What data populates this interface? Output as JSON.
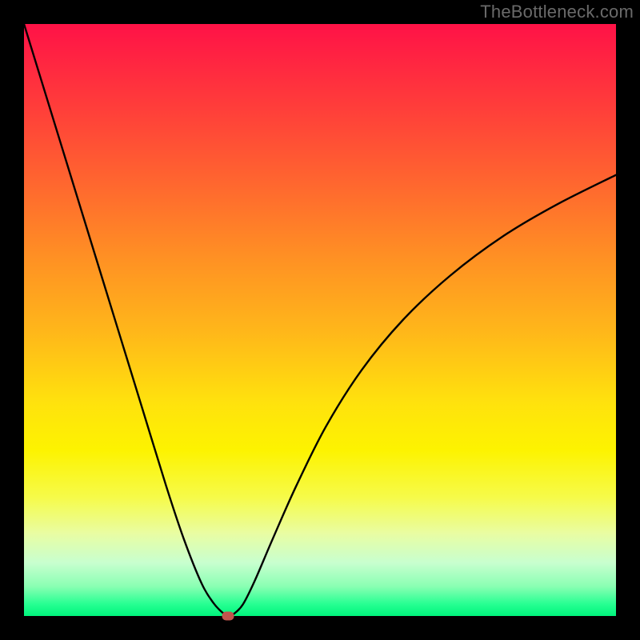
{
  "watermark": "TheBottleneck.com",
  "chart_data": {
    "type": "line",
    "title": "",
    "xlabel": "",
    "ylabel": "",
    "xlim": [
      0,
      1
    ],
    "ylim": [
      0,
      1
    ],
    "gradient_colors": {
      "top": "#ff1247",
      "mid": "#ffe20d",
      "bottom": "#00f47c"
    },
    "series": [
      {
        "name": "bottleneck-curve",
        "x": [
          0.0,
          0.04,
          0.08,
          0.12,
          0.16,
          0.2,
          0.24,
          0.27,
          0.3,
          0.32,
          0.335,
          0.345,
          0.355,
          0.37,
          0.39,
          0.42,
          0.46,
          0.51,
          0.57,
          0.64,
          0.72,
          0.81,
          0.9,
          1.0
        ],
        "y": [
          1.0,
          0.87,
          0.74,
          0.61,
          0.48,
          0.35,
          0.22,
          0.13,
          0.055,
          0.022,
          0.006,
          0.0,
          0.004,
          0.02,
          0.06,
          0.13,
          0.22,
          0.32,
          0.415,
          0.5,
          0.575,
          0.642,
          0.695,
          0.745
        ]
      }
    ],
    "annotations": [
      {
        "name": "balance-point-marker",
        "x": 0.345,
        "y": 0.0,
        "color": "#c2544d"
      }
    ]
  }
}
